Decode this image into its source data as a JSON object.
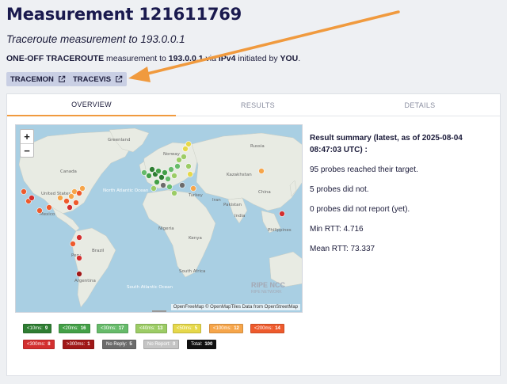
{
  "page": {
    "title": "Measurement 121611769",
    "subtitle": "Traceroute measurement to 193.0.0.1",
    "desc_type": "ONE-OFF TRACEROUTE",
    "desc_t1": " measurement to ",
    "desc_target": "193.0.0.1",
    "desc_t2": " via ",
    "desc_proto": "IPv4",
    "desc_t3": " initiated by ",
    "desc_user": "YOU",
    "desc_t4": "."
  },
  "tools": [
    {
      "label": "TRACEMON",
      "icon": "external-link-icon"
    },
    {
      "label": "TRACEVIS",
      "icon": "external-link-icon"
    }
  ],
  "tabs": [
    "OVERVIEW",
    "RESULTS",
    "DETAILS"
  ],
  "active_tab": "OVERVIEW",
  "map": {
    "zoom_in": "+",
    "zoom_out": "−",
    "attribution": "OpenFreeMap © OpenMapTiles Data from OpenStreetMap",
    "brand": "RIPE NCC",
    "brand_sub": "RIPE NETWORK",
    "labels": {
      "greenland": "Greenland",
      "canada": "Canada",
      "usa": "United States",
      "mexico": "Mexico",
      "north_atlantic": "North Atlantic Ocean",
      "brazil": "Brazil",
      "peru": "Peru",
      "argentina": "Argentina",
      "south_atlantic": "South Atlantic Ocean",
      "nigeria": "Nigeria",
      "kenya": "Kenya",
      "south_africa": "South Africa",
      "russia": "Russia",
      "pakistan": "Pakistan",
      "kazakhstan": "Kazakhstan",
      "turkey": "Turkey",
      "iran": "Iran",
      "india": "India",
      "china": "China",
      "philippines": "Philippines",
      "norway": "Norway"
    }
  },
  "summary": {
    "heading": "Result summary (latest, as of 2025-08-04 08:47:03 UTC) :",
    "reached": "95 probes reached their target.",
    "not_reached": "5 probes did not.",
    "no_report": "0 probes did not report (yet).",
    "min_rtt": "Min RTT: 4.716",
    "mean_rtt": "Mean RTT: 73.337"
  },
  "legend": [
    {
      "label": "<10ms:",
      "count": "9",
      "color": "#2e7d32",
      "text": "#ffffff"
    },
    {
      "label": "<20ms:",
      "count": "16",
      "color": "#43a047",
      "text": "#ffffff"
    },
    {
      "label": "<30ms:",
      "count": "17",
      "color": "#66bb6a",
      "text": "#ffffff"
    },
    {
      "label": "<40ms:",
      "count": "13",
      "color": "#9ccc65",
      "text": "#ffffff"
    },
    {
      "label": "<50ms:",
      "count": "5",
      "color": "#e6d84a",
      "text": "#ffffff"
    },
    {
      "label": "<100ms:",
      "count": "12",
      "color": "#f6a54a",
      "text": "#ffffff"
    },
    {
      "label": "<200ms:",
      "count": "14",
      "color": "#ee5a2c",
      "text": "#ffffff"
    },
    {
      "label": "<300ms:",
      "count": "8",
      "color": "#d32f2f",
      "text": "#ffffff"
    },
    {
      "label": ">300ms:",
      "count": "1",
      "color": "#a01818",
      "text": "#ffffff"
    },
    {
      "label": "No Reply:",
      "count": "5",
      "color": "#6b6b6b",
      "text": "#ffffff"
    },
    {
      "label": "No Report:",
      "count": "0",
      "color": "#c4c4c4",
      "text": "#ffffff"
    },
    {
      "label": "Total:",
      "count": "100",
      "color": "#111111",
      "text": "#ffffff"
    }
  ],
  "colors": {
    "accent": "#f09a3e",
    "title": "#1a1a4e",
    "tool_bg": "#c9cfe4"
  }
}
